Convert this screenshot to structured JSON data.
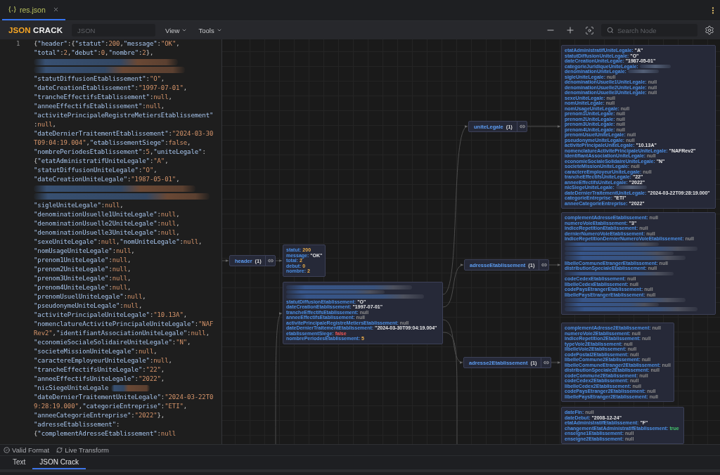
{
  "file_tabs": [
    {
      "label": "res.json",
      "selected": true
    }
  ],
  "toolbar": {
    "logo_primary": "JSON",
    "logo_secondary": "CRACK",
    "format_field": {
      "placeholder": "JSON"
    },
    "menus": [
      "View",
      "Tools"
    ],
    "search": {
      "placeholder": "Search Node"
    }
  },
  "editor": {
    "line_number": "1",
    "lines": [
      {
        "kind": "code",
        "text": "{\"header\":{\"statut\":200,\"message\":\"OK\","
      },
      {
        "kind": "code",
        "text": "\"total\":2,\"debut\":0,\"nombre\":2},"
      },
      {
        "kind": "blurred"
      },
      {
        "kind": "blurred"
      },
      {
        "kind": "code",
        "text": "\"statutDiffusionEtablissement\":\"O\","
      },
      {
        "kind": "code",
        "text": "\"dateCreationEtablissement\":\"1997-07-01\","
      },
      {
        "kind": "code",
        "text": "\"trancheEffectifsEtablissement\":null,"
      },
      {
        "kind": "code",
        "text": "\"anneeEffectifsEtablissement\":null,"
      },
      {
        "kind": "code",
        "text": "\"activitePrincipaleRegistreMetiersEtablissement\""
      },
      {
        "kind": "code",
        "text": ":null,"
      },
      {
        "kind": "code",
        "text": "\"dateDernierTraitementEtablissement\":\"2024-03-30"
      },
      {
        "kind": "code",
        "text": "T09:04:19.004\",\"etablissementSiege\":false,"
      },
      {
        "kind": "code",
        "text": "\"nombrePeriodesEtablissement\":5,\"uniteLegale\":"
      },
      {
        "kind": "code",
        "text": "{\"etatAdministratifUniteLegale\":\"A\","
      },
      {
        "kind": "code",
        "text": "\"statutDiffusionUniteLegale\":\"O\","
      },
      {
        "kind": "code",
        "text": "\"dateCreationUniteLegale\":\"1987-05-01\","
      },
      {
        "kind": "blurred"
      },
      {
        "kind": "blurred"
      },
      {
        "kind": "code",
        "text": "\"sigleUniteLegale\":null,"
      },
      {
        "kind": "code",
        "text": "\"denominationUsuelle1UniteLegale\":null,"
      },
      {
        "kind": "code",
        "text": "\"denominationUsuelle2UniteLegale\":null,"
      },
      {
        "kind": "code",
        "text": "\"denominationUsuelle3UniteLegale\":null,"
      },
      {
        "kind": "code",
        "text": "\"sexeUniteLegale\":null,\"nomUniteLegale\":null,"
      },
      {
        "kind": "code",
        "text": "\"nomUsageUniteLegale\":null,"
      },
      {
        "kind": "code",
        "text": "\"prenom1UniteLegale\":null,"
      },
      {
        "kind": "code",
        "text": "\"prenom2UniteLegale\":null,"
      },
      {
        "kind": "code",
        "text": "\"prenom3UniteLegale\":null,"
      },
      {
        "kind": "code",
        "text": "\"prenom4UniteLegale\":null,"
      },
      {
        "kind": "code",
        "text": "\"prenomUsuelUniteLegale\":null,"
      },
      {
        "kind": "code",
        "text": "\"pseudonymeUniteLegale\":null,"
      },
      {
        "kind": "code",
        "text": "\"activitePrincipaleUniteLegale\":\"10.13A\","
      },
      {
        "kind": "code",
        "text": "\"nomenclatureActivitePrincipaleUniteLegale\":\"NAF"
      },
      {
        "kind": "code",
        "text": "Rev2\",\"identifiantAssociationUniteLegale\":null,"
      },
      {
        "kind": "code",
        "text": "\"economieSocialeSolidaireUniteLegale\":\"N\","
      },
      {
        "kind": "code",
        "text": "\"societeMissionUniteLegale\":null,"
      },
      {
        "kind": "code",
        "text": "\"caractereEmployeurUniteLegale\":null,"
      },
      {
        "kind": "code",
        "text": "\"trancheEffectifsUniteLegale\":\"22\","
      },
      {
        "kind": "code",
        "text": "\"anneeEffectifsUniteLegale\":\"2022\","
      },
      {
        "kind": "partial",
        "text": "\"nicSiegeUniteLegale"
      },
      {
        "kind": "code",
        "text": "\"dateDernierTraitementUniteLegale\":\"2024-03-22T0"
      },
      {
        "kind": "code",
        "text": "9:28:19.000\",\"categorieEntreprise\":\"ETI\","
      },
      {
        "kind": "code",
        "text": "\"anneeCategorieEntreprise\":\"2022\"},"
      },
      {
        "kind": "code",
        "text": "\"adresseEtablissement\":"
      },
      {
        "kind": "code",
        "text": "{\"complementAdresseEtablissement\":null"
      }
    ]
  },
  "graph": {
    "nodes": [
      {
        "kind": "parent",
        "label": "header",
        "count": "(1)"
      },
      {
        "kind": "object",
        "rows": [
          {
            "kind": "number",
            "key": "statut:",
            "value": "200"
          },
          {
            "kind": "string",
            "key": "message:",
            "value": "\"OK\""
          },
          {
            "kind": "number",
            "key": "total:",
            "value": "2"
          },
          {
            "kind": "number",
            "key": "debut:",
            "value": "0"
          },
          {
            "kind": "number",
            "key": "nombre:",
            "value": "2"
          }
        ]
      },
      {
        "kind": "object",
        "rows": [
          {
            "kind": "redacted"
          },
          {
            "kind": "redacted"
          },
          {
            "kind": "redacted"
          },
          {
            "kind": "string",
            "key": "statutDiffusionEtablissement:",
            "value": "\"O\""
          },
          {
            "kind": "string",
            "key": "dateCreationEtablissement:",
            "value": "\"1997-07-01\""
          },
          {
            "kind": "null",
            "key": "trancheEffectifsEtablissement:",
            "value": "null"
          },
          {
            "kind": "null",
            "key": "anneeEffectifsEtablissement:",
            "value": "null"
          },
          {
            "kind": "null",
            "key": "activitePrincipaleRegistreMetiersEtablissement:",
            "value": "null"
          },
          {
            "kind": "string",
            "key": "dateDernierTraitementEtablissement:",
            "value": "\"2024-03-30T09:04:19.004\""
          },
          {
            "kind": "false",
            "key": "etablissementSiege:",
            "value": "false"
          },
          {
            "kind": "number",
            "key": "nombrePeriodesEtablissement:",
            "value": "5"
          }
        ]
      },
      {
        "kind": "parent",
        "label": "uniteLegale",
        "count": "(1)"
      },
      {
        "kind": "object",
        "rows": [
          {
            "kind": "string",
            "key": "etatAdministratifUniteLegale:",
            "value": "\"A\""
          },
          {
            "kind": "string",
            "key": "statutDiffusionUniteLegale:",
            "value": "\"O\""
          },
          {
            "kind": "string",
            "key": "dateCreationUniteLegale:",
            "value": "\"1987-05-01\""
          },
          {
            "kind": "partial",
            "key": "categorieJuridiqueUniteLegale:"
          },
          {
            "kind": "partial",
            "key": "denominationUniteLegale:"
          },
          {
            "kind": "null",
            "key": "sigleUniteLegale:",
            "value": "null"
          },
          {
            "kind": "null",
            "key": "denominationUsuelle1UniteLegale:",
            "value": "null"
          },
          {
            "kind": "null",
            "key": "denominationUsuelle2UniteLegale:",
            "value": "null"
          },
          {
            "kind": "null",
            "key": "denominationUsuelle3UniteLegale:",
            "value": "null"
          },
          {
            "kind": "null",
            "key": "sexeUniteLegale:",
            "value": "null"
          },
          {
            "kind": "null",
            "key": "nomUniteLegale:",
            "value": "null"
          },
          {
            "kind": "null",
            "key": "nomUsageUniteLegale:",
            "value": "null"
          },
          {
            "kind": "null",
            "key": "prenom1UniteLegale:",
            "value": "null"
          },
          {
            "kind": "null",
            "key": "prenom2UniteLegale:",
            "value": "null"
          },
          {
            "kind": "null",
            "key": "prenom3UniteLegale:",
            "value": "null"
          },
          {
            "kind": "null",
            "key": "prenom4UniteLegale:",
            "value": "null"
          },
          {
            "kind": "null",
            "key": "prenomUsuelUniteLegale:",
            "value": "null"
          },
          {
            "kind": "null",
            "key": "pseudonymeUniteLegale:",
            "value": "null"
          },
          {
            "kind": "string",
            "key": "activitePrincipaleUniteLegale:",
            "value": "\"10.13A\""
          },
          {
            "kind": "string",
            "key": "nomenclatureActivitePrincipaleUniteLegale:",
            "value": "\"NAFRev2\""
          },
          {
            "kind": "null",
            "key": "identifiantAssociationUniteLegale:",
            "value": "null"
          },
          {
            "kind": "string",
            "key": "economieSocialeSolidaireUniteLegale:",
            "value": "\"N\""
          },
          {
            "kind": "null",
            "key": "societeMissionUniteLegale:",
            "value": "null"
          },
          {
            "kind": "null",
            "key": "caractereEmployeurUniteLegale:",
            "value": "null"
          },
          {
            "kind": "string",
            "key": "trancheEffectifsUniteLegale:",
            "value": "\"22\""
          },
          {
            "kind": "string",
            "key": "anneeEffectifsUniteLegale:",
            "value": "\"2022\""
          },
          {
            "kind": "partial",
            "key": "nicSiegeUniteLegale:"
          },
          {
            "kind": "string",
            "key": "dateDernierTraitementUniteLegale:",
            "value": "\"2024-03-22T09:28:19.000\""
          },
          {
            "kind": "string",
            "key": "categorieEntreprise:",
            "value": "\"ETI\""
          },
          {
            "kind": "string",
            "key": "anneeCategorieEntreprise:",
            "value": "\"2022\""
          }
        ]
      },
      {
        "kind": "parent",
        "label": "adresseEtablissement",
        "count": "(1)"
      },
      {
        "kind": "object",
        "rows": [
          {
            "kind": "null",
            "key": "complementAdresseEtablissement:",
            "value": "null"
          },
          {
            "kind": "string",
            "key": "numeroVoieEtablissement:",
            "value": "\"3\""
          },
          {
            "kind": "null",
            "key": "indiceRepetitionEtablissement:",
            "value": "null"
          },
          {
            "kind": "null",
            "key": "dernierNumeroVoieEtablissement:",
            "value": "null"
          },
          {
            "kind": "null",
            "key": "indiceRepetitionDernierNumeroVoieEtablissement:",
            "value": "null"
          },
          {
            "kind": "redacted"
          },
          {
            "kind": "redacted"
          },
          {
            "kind": "redacted"
          },
          {
            "kind": "redacted"
          },
          {
            "kind": "null",
            "key": "libelleCommuneEtrangerEtablissement:",
            "value": "null"
          },
          {
            "kind": "null",
            "key": "distributionSpecialeEtablissement:",
            "value": "null"
          },
          {
            "kind": "redacted"
          },
          {
            "kind": "null",
            "key": "codeCedexEtablissement:",
            "value": "null"
          },
          {
            "kind": "null",
            "key": "libelleCedexEtablissement:",
            "value": "null"
          },
          {
            "kind": "null",
            "key": "codePaysEtrangerEtablissement:",
            "value": "null"
          },
          {
            "kind": "null",
            "key": "libellePaysEtrangerEtablissement:",
            "value": "null"
          },
          {
            "kind": "redacted"
          },
          {
            "kind": "redacted"
          },
          {
            "kind": "redacted"
          }
        ]
      },
      {
        "kind": "parent",
        "label": "adresse2Etablissement",
        "count": "(1)"
      },
      {
        "kind": "object",
        "rows": [
          {
            "kind": "null",
            "key": "complementAdresse2Etablissement:",
            "value": "null"
          },
          {
            "kind": "null",
            "key": "numeroVoie2Etablissement:",
            "value": "null"
          },
          {
            "kind": "null",
            "key": "indiceRepetition2Etablissement:",
            "value": "null"
          },
          {
            "kind": "null",
            "key": "typeVoie2Etablissement:",
            "value": "null"
          },
          {
            "kind": "null",
            "key": "libelleVoie2Etablissement:",
            "value": "null"
          },
          {
            "kind": "null",
            "key": "codePostal2Etablissement:",
            "value": "null"
          },
          {
            "kind": "null",
            "key": "libelleCommune2Etablissement:",
            "value": "null"
          },
          {
            "kind": "null",
            "key": "libelleCommuneEtranger2Etablissement:",
            "value": "null"
          },
          {
            "kind": "null",
            "key": "distributionSpeciale2Etablissement:",
            "value": "null"
          },
          {
            "kind": "null",
            "key": "codeCommune2Etablissement:",
            "value": "null"
          },
          {
            "kind": "null",
            "key": "codeCedex2Etablissement:",
            "value": "null"
          },
          {
            "kind": "null",
            "key": "libelleCedex2Etablissement:",
            "value": "null"
          },
          {
            "kind": "null",
            "key": "codePaysEtranger2Etablissement:",
            "value": "null"
          },
          {
            "kind": "null",
            "key": "libellePaysEtranger2Etablissement:",
            "value": "null"
          }
        ]
      },
      {
        "kind": "object",
        "rows": [
          {
            "kind": "null",
            "key": "dateFin:",
            "value": "null"
          },
          {
            "kind": "string",
            "key": "dateDebut:",
            "value": "\"2008-12-24\""
          },
          {
            "kind": "string",
            "key": "etatAdministratifEtablissement:",
            "value": "\"F\""
          },
          {
            "kind": "true",
            "key": "changementEtatAdministratifEtablissement:",
            "value": "true"
          },
          {
            "kind": "null",
            "key": "enseigne1Etablissement:",
            "value": "null"
          },
          {
            "kind": "null",
            "key": "enseigne2Etablissement:",
            "value": "null"
          }
        ]
      }
    ]
  },
  "status_bar": {
    "items": [
      {
        "kind": "status",
        "label": "Valid Format"
      },
      {
        "kind": "toggle",
        "label": "Live Transform"
      }
    ]
  },
  "view_tabs": [
    {
      "label": "Text",
      "selected": false
    },
    {
      "label": "JSON Crack",
      "selected": true
    }
  ]
}
